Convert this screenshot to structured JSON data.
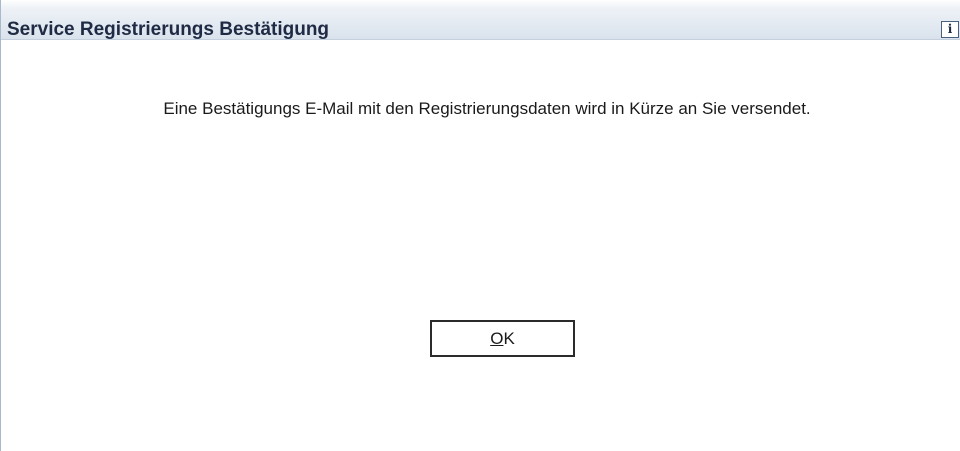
{
  "dialog": {
    "title": "Service Registrierungs Bestätigung",
    "info_glyph": "i",
    "message": "Eine Bestätigungs E-Mail mit den Registrierungsdaten wird in Kürze an Sie versendet.",
    "ok_button": {
      "mnemonic": "O",
      "rest": "K"
    }
  },
  "icons": {
    "info": "info-icon"
  },
  "colors": {
    "title_text": "#1f2a44",
    "title_bar": "#d9e2ec",
    "button_border": "#2b2b2b"
  }
}
